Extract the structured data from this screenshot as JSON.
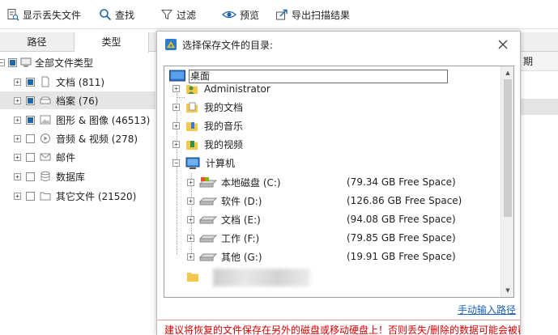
{
  "toolbar": {
    "show_lost": "显示丢失文件",
    "search": "查找",
    "filter": "过滤",
    "preview": "预览",
    "export": "导出扫描结果"
  },
  "tabs": {
    "path": "路径",
    "type": "类型"
  },
  "tree": {
    "root": "全部文件类型",
    "items": [
      {
        "label": "文档 (811)"
      },
      {
        "label": "档案 (76)"
      },
      {
        "label": "图形 & 图像 (46513)"
      },
      {
        "label": "音频 & 视频 (278)"
      },
      {
        "label": "邮件"
      },
      {
        "label": "数据库"
      },
      {
        "label": "其它文件 (21520)"
      }
    ]
  },
  "list": {
    "column_partial": "期"
  },
  "dialog": {
    "title": "选择保存文件的目录:",
    "desktop": "桌面",
    "folders": [
      "Administrator",
      "我的文档",
      "我的音乐",
      "我的视频",
      "计算机"
    ],
    "drives": [
      {
        "name": "本地磁盘 (C:)",
        "free": "(79.34 GB Free Space)"
      },
      {
        "name": "软件 (D:)",
        "free": "(126.86 GB Free Space)"
      },
      {
        "name": "文档 (E:)",
        "free": "(94.08 GB Free Space)"
      },
      {
        "name": "工作 (F:)",
        "free": "(79.85 GB Free Space)"
      },
      {
        "name": "其他 (G:)",
        "free": "(19.91 GB Free Space)"
      }
    ],
    "manual_input": "手动输入路径",
    "warning": "建议将恢复的文件保存在另外的磁盘或移动硬盘上！否则丢失/删除的数据可能会被覆盖"
  },
  "colors": {
    "accent": "#1f67a8",
    "warning": "#d40000",
    "link": "#1a5fb4"
  }
}
